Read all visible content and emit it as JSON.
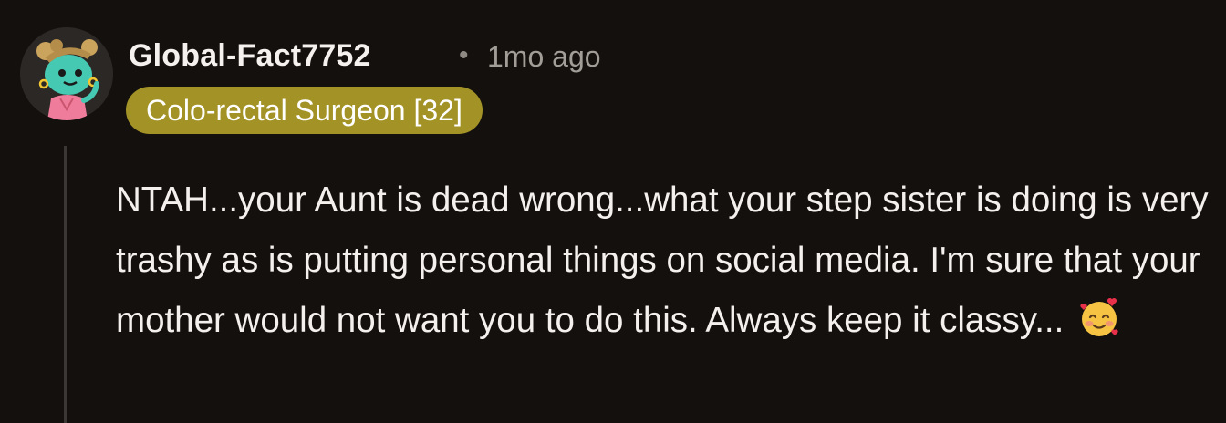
{
  "comment": {
    "author": "Global-Fact7752",
    "separator": "•",
    "timestamp": "1mo ago",
    "flair": "Colo-rectal Surgeon [32]",
    "body": "NTAH...your Aunt is dead wrong...what your step sister is doing is very trashy as is putting personal things on social media. I'm sure that your mother would not want you to do this. Always keep it classy...",
    "emoji_icon": "smiling-face-with-hearts-icon"
  },
  "colors": {
    "background": "#13100e",
    "flair_background": "#a39226",
    "text": "#f3f0ed",
    "muted_text": "#a29d97",
    "thread_line": "#3a3734"
  }
}
